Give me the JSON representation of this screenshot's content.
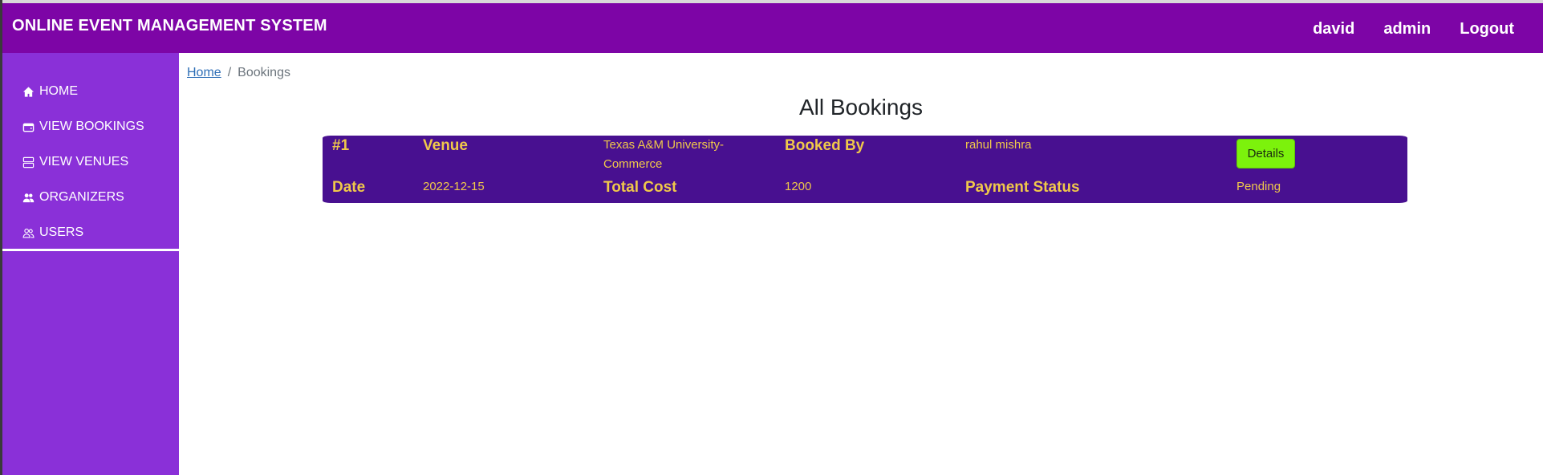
{
  "app": {
    "title": "ONLINE EVENT MANAGEMENT SYSTEM"
  },
  "navbar": {
    "user": "david",
    "admin": "admin",
    "logout": "Logout"
  },
  "sidebar": {
    "items": [
      {
        "label": "HOME",
        "icon": "home-icon"
      },
      {
        "label": "VIEW BOOKINGS",
        "icon": "wallet-icon"
      },
      {
        "label": "VIEW VENUES",
        "icon": "server-icon"
      },
      {
        "label": "ORGANIZERS",
        "icon": "people-fill-icon"
      },
      {
        "label": "USERS",
        "icon": "people-outline-icon"
      }
    ]
  },
  "breadcrumb": {
    "home": "Home",
    "separator": "/",
    "current": "Bookings"
  },
  "page": {
    "title": "All Bookings"
  },
  "booking": {
    "id": "#1",
    "venue_label": "Venue",
    "venue_line1": "Texas A&M University-",
    "venue_line2": "Commerce",
    "booked_by_label": "Booked By",
    "booked_by": "rahul mishra",
    "details_button": "Details",
    "date_label": "Date",
    "date": "2022-12-15",
    "total_cost_label": "Total Cost",
    "total_cost": "1200",
    "payment_status_label": "Payment Status",
    "payment_status": "Pending"
  },
  "colors": {
    "navbar": "#7d05a6",
    "sidebar": "#8a30d8",
    "card": "#481090",
    "card_text": "#f0c84a",
    "details_button": "#7cf20c"
  }
}
